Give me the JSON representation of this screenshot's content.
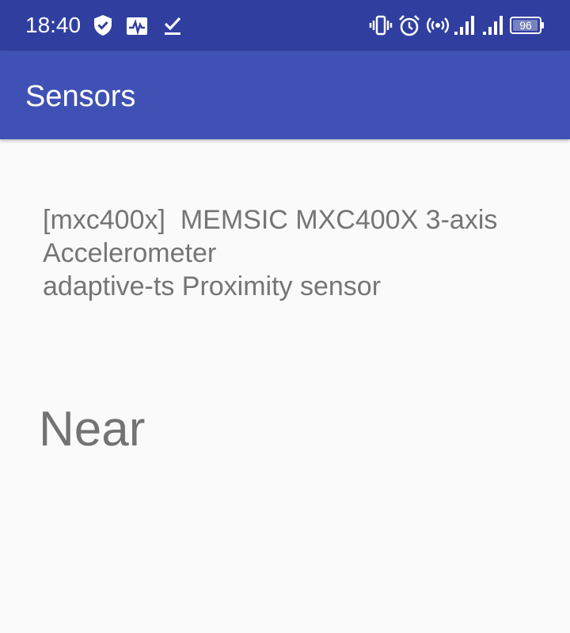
{
  "status_bar": {
    "time": "18:40",
    "battery_level": "96",
    "battery_fraction": 0.96,
    "icons": [
      "shield-check-icon",
      "activity-chart-icon",
      "download-done-icon",
      "vibrate-icon",
      "alarm-icon",
      "hotspot-icon",
      "signal-icon",
      "signal-icon"
    ]
  },
  "app_bar": {
    "title": "Sensors"
  },
  "sensors": {
    "line_1": "[mxc400x]  MEMSIC MXC400X 3-axis",
    "line_2": "Accelerometer",
    "line_3": "adaptive-ts Proximity sensor"
  },
  "proximity": {
    "value": "Near"
  },
  "colors": {
    "status_bar": "#303f9f",
    "app_bar": "#3f51b5",
    "background": "#fafafa",
    "text_secondary": "#757575"
  }
}
